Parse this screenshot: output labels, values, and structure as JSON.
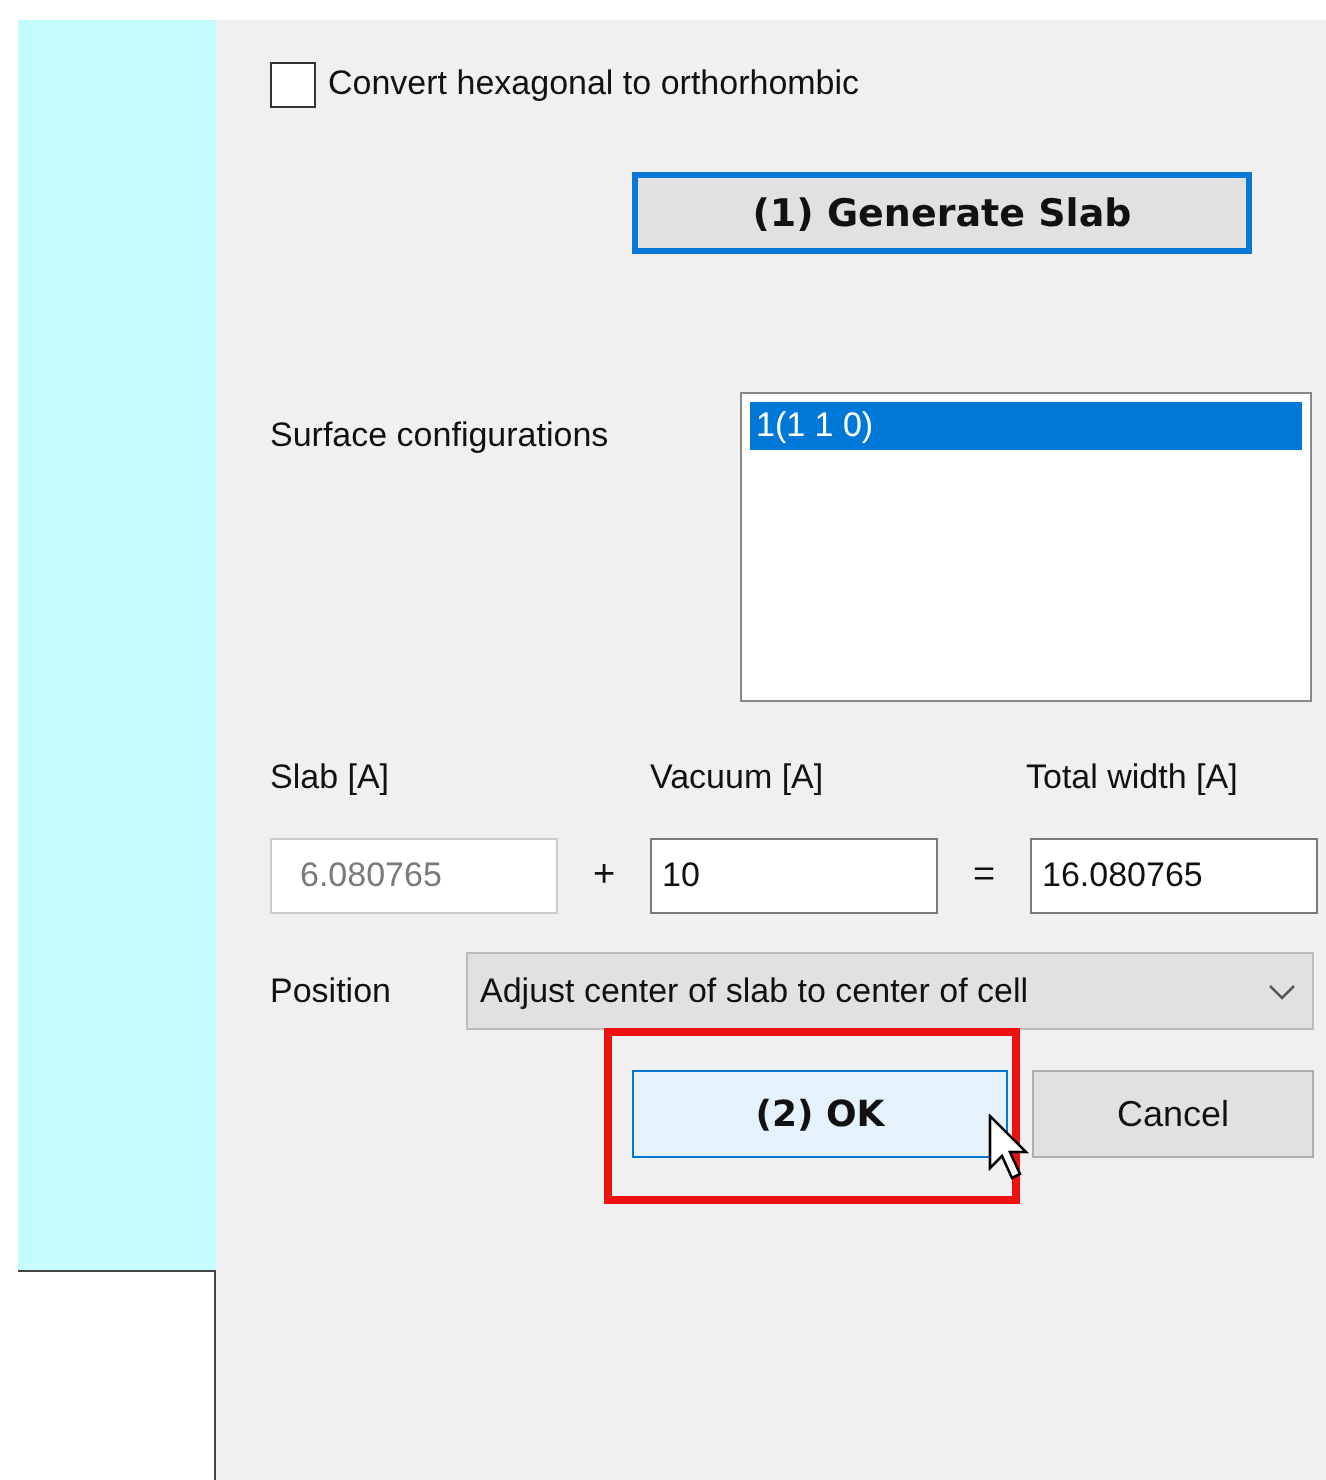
{
  "convert_checkbox": {
    "label": "Convert hexagonal to orthorhombic",
    "checked": false
  },
  "generate_button": {
    "label": "(1) Generate Slab",
    "focused": true
  },
  "surface_configurations": {
    "label": "Surface configurations",
    "items": [
      {
        "text": "1(1 1 0)",
        "selected": true
      }
    ]
  },
  "width_fields": [
    {
      "label": "Slab [A]",
      "value": "6.080765",
      "disabled": true,
      "operator": "+"
    },
    {
      "label": "Vacuum [A]",
      "value": "10",
      "disabled": false,
      "operator": "="
    },
    {
      "label": "Total width [A]",
      "value": "16.080765",
      "disabled": false
    }
  ],
  "position": {
    "label": "Position",
    "value": "Adjust center of slab to center of cell"
  },
  "buttons": [
    {
      "label": "(2) OK",
      "kind": "primary",
      "highlighted": true
    },
    {
      "label": "Cancel",
      "kind": "normal",
      "highlighted": false
    }
  ]
}
